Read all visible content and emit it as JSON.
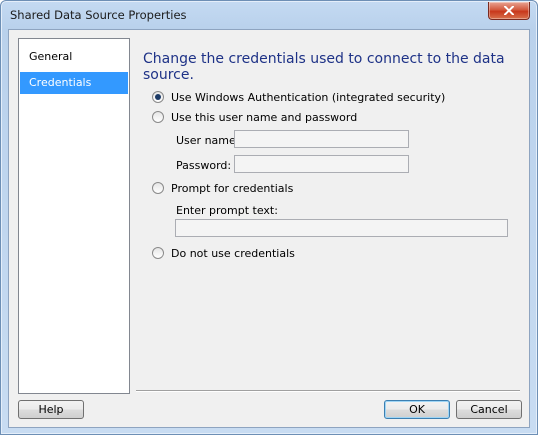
{
  "window": {
    "title": "Shared Data Source Properties"
  },
  "nav": {
    "items": [
      {
        "label": "General"
      },
      {
        "label": "Credentials"
      }
    ]
  },
  "credentials": {
    "heading": "Change the credentials used to connect to the data source.",
    "options": {
      "windows_auth": "Use Windows Authentication (integrated security)",
      "user_password": "Use this user name and password",
      "prompt": "Prompt for credentials",
      "none": "Do not use credentials"
    },
    "username_label": "User name:",
    "username_value": "",
    "password_label": "Password:",
    "password_value": "",
    "prompt_text_label": "Enter prompt text:",
    "prompt_text_value": ""
  },
  "buttons": {
    "help": "Help",
    "ok": "OK",
    "cancel": "Cancel"
  }
}
